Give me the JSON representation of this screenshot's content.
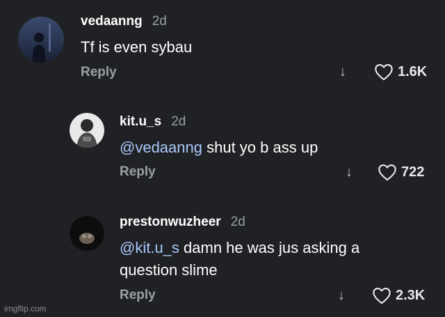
{
  "comments": [
    {
      "username": "vedaanng",
      "time": "2d",
      "text": "Tf is even sybau",
      "reply_label": "Reply",
      "like_count": "1.6K"
    },
    {
      "username": "kit.u_s",
      "time": "2d",
      "mention": "@vedaanng",
      "text": " shut yo b ass up",
      "reply_label": "Reply",
      "like_count": "722"
    },
    {
      "username": "prestonwuzheer",
      "time": "2d",
      "mention": "@kit.u_s",
      "text_line1": " damn he was jus asking a",
      "text_line2": "question slime",
      "reply_label": "Reply",
      "like_count": "2.3K"
    }
  ],
  "icons": {
    "down_arrow": "↓",
    "heart": "heart-outline"
  },
  "watermark": "imgflip.com",
  "colors": {
    "background": "#202124",
    "mention": "#a8c7fa",
    "secondary_text": "#9aa0a6"
  }
}
